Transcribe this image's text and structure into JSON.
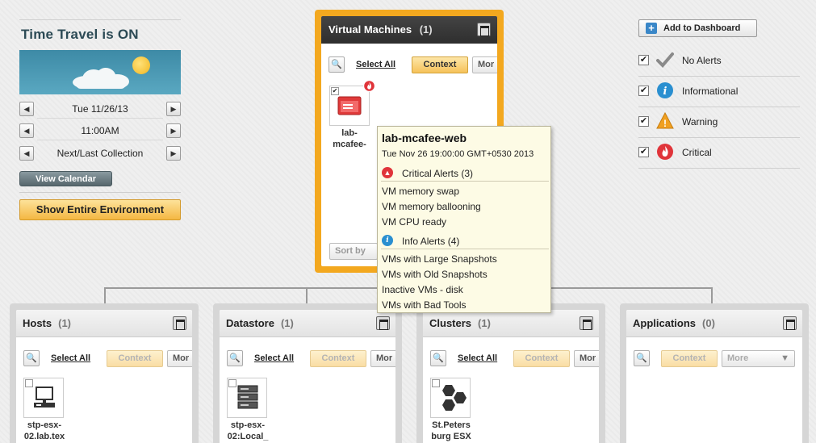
{
  "left": {
    "title": "Time Travel is ON",
    "date": "Tue 11/26/13",
    "time": "11:00AM",
    "collection": "Next/Last Collection",
    "view_calendar": "View Calendar",
    "show_env": "Show Entire Environment"
  },
  "right": {
    "add_dashboard": "Add to Dashboard",
    "legend": [
      {
        "label": "No Alerts",
        "icon": "checkmark-icon"
      },
      {
        "label": "Informational",
        "icon": "info-icon"
      },
      {
        "label": "Warning",
        "icon": "warning-icon"
      },
      {
        "label": "Critical",
        "icon": "critical-icon"
      }
    ]
  },
  "vm": {
    "title": "Virtual Machines",
    "count": "(1)",
    "select_all": "Select All",
    "context": "Context",
    "more": "Mor",
    "sort": "Sort by",
    "item_label_1": "lab-",
    "item_label_2": "mcafee-"
  },
  "panels": {
    "hosts": {
      "title": "Hosts",
      "count": "(1)",
      "select_all": "Select All",
      "context": "Context",
      "more": "Mor",
      "item1": "stp-esx-",
      "item2": "02.lab.tex"
    },
    "datastore": {
      "title": "Datastore",
      "count": "(1)",
      "select_all": "Select All",
      "context": "Context",
      "more": "Mor",
      "item1": "stp-esx-",
      "item2": "02:Local_"
    },
    "clusters": {
      "title": "Clusters",
      "count": "(1)",
      "select_all": "Select All",
      "context": "Context",
      "more": "Mor",
      "item1": "St.Peters",
      "item2": "burg ESX"
    },
    "applications": {
      "title": "Applications",
      "count": "(0)",
      "context": "Context",
      "more": "More"
    }
  },
  "tooltip": {
    "title": "lab-mcafee-web",
    "date": "Tue Nov 26 19:00:00 GMT+0530 2013",
    "critical_header": "Critical Alerts (3)",
    "critical": [
      "VM memory swap",
      "VM memory ballooning",
      "VM CPU ready"
    ],
    "info_header": "Info Alerts (4)",
    "info": [
      "VMs with Large Snapshots",
      "VMs with Old Snapshots",
      "Inactive VMs - disk",
      "VMs with Bad Tools"
    ]
  },
  "colors": {
    "accent": "#f3a81f",
    "critical": "#e0343a",
    "info": "#2a8fd0",
    "warning": "#f0a020"
  }
}
